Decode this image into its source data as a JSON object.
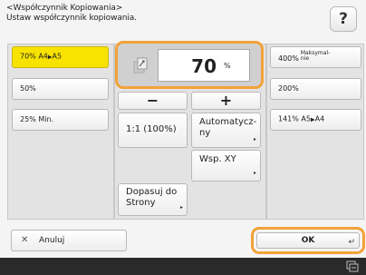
{
  "header": {
    "title_line1": "<Współczynnik Kopiowania>",
    "title_line2": "Ustaw współczynnik kopiowania.",
    "help_label": "?"
  },
  "presets_left": [
    {
      "label": "70% A4",
      "suffix": "A5",
      "selected": true
    },
    {
      "label": "50%",
      "suffix": "",
      "selected": false
    },
    {
      "label": "25% Min.",
      "suffix": "",
      "selected": false
    }
  ],
  "ratio": {
    "icon": "zoom-icon",
    "value": "70",
    "unit": "%"
  },
  "minus_label": "−",
  "plus_label": "+",
  "one_to_one_label": "1:1 (100%)",
  "auto_label": "Automatycz-ny",
  "xy_label": "Wsp. XY",
  "fit_label": "Dopasuj do Strony",
  "presets_right": [
    {
      "label": "400%",
      "suffix": "Maksymal-nie"
    },
    {
      "label": "200%",
      "suffix": ""
    },
    {
      "label": "141% A5",
      "suffix": "A4"
    }
  ],
  "cancel_label": "Anuluj",
  "ok_label": "OK",
  "colors": {
    "selected": "#f8e300",
    "highlight": "#f2a23a",
    "statusbar": "#2a2a2a"
  }
}
